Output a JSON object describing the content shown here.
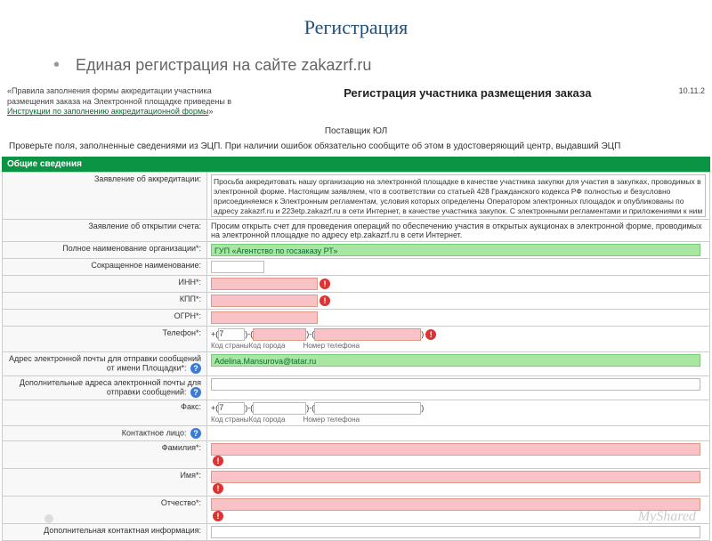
{
  "slide": {
    "title": "Регистрация",
    "subtitle": "Единая регистрация на сайте zakazrf.ru"
  },
  "top": {
    "rules_pre": "«Правила заполнения формы аккредитации участника размещения заказа на Электронной площадке приведены в ",
    "rules_link": "Инструкции по заполнению аккредитационной формы",
    "rules_post": "»",
    "page_title": "Регистрация участника размещения заказа",
    "date": "10.11.2",
    "provider": "Поставщик ЮЛ",
    "warning": "Проверьте поля, заполненные сведениями из ЭЦП. При наличии ошибок обязательно сообщите об этом в удостоверяющий центр, выдавший ЭЦП"
  },
  "section": "Общие сведения",
  "labels": {
    "accred": "Заявление об аккредитации:",
    "account": "Заявление об открытии счета:",
    "orgname": "Полное наименование организации*:",
    "shortname": "Сокращенное наименование:",
    "inn": "ИНН*:",
    "kpp": "КПП*:",
    "ogrn": "ОГРН*:",
    "phone": "Телефон*:",
    "email": "Адрес электронной почты для отправки сообщений от имени Площадки*:",
    "email2": "Дополнительные адреса электронной почты для отправки сообщений:",
    "fax": "Факс:",
    "contact": "Контактное лицо:",
    "lastname": "Фамилия*:",
    "firstname": "Имя*:",
    "middlename": "Отчество*:",
    "addinfo": "Дополнительная контактная информация:"
  },
  "values": {
    "accred_text": "Просьба аккредитовать нашу организацию на электронной площадке в качестве участника закупки для участия в закупках, проводимых в электронной форме. Настоящим заявляем, что в соответствии со статьей 428 Гражданского кодекса РФ полностью и безусловно присоединяемся к Электронным регламентам, условия которых определены Оператором электронных площадок и опубликованы по адресу zakazrf.ru и 223etp.zakazrf.ru в сети Интернет, в качестве участника закупок. С электронными регламентами и приложениями к ним ознакомлены и обязуемся соблюдать все положения указанных документов.",
    "account_text": "Просим открыть счет для проведения операций по обеспечению участия в открытых аукционах в электронной форме, проводимых на электронной площадке по адресу etp.zakazrf.ru в сети Интернет.",
    "orgname": "ГУП «Агентство по госзаказу РТ»",
    "email": "Adelina.Mansurova@tatar.ru",
    "phone_code": "7",
    "fax_code": "7",
    "phone_hint1": "Код страны",
    "phone_hint2": "Код города",
    "phone_hint3": "Номер телефона"
  },
  "watermark": "MyShared"
}
